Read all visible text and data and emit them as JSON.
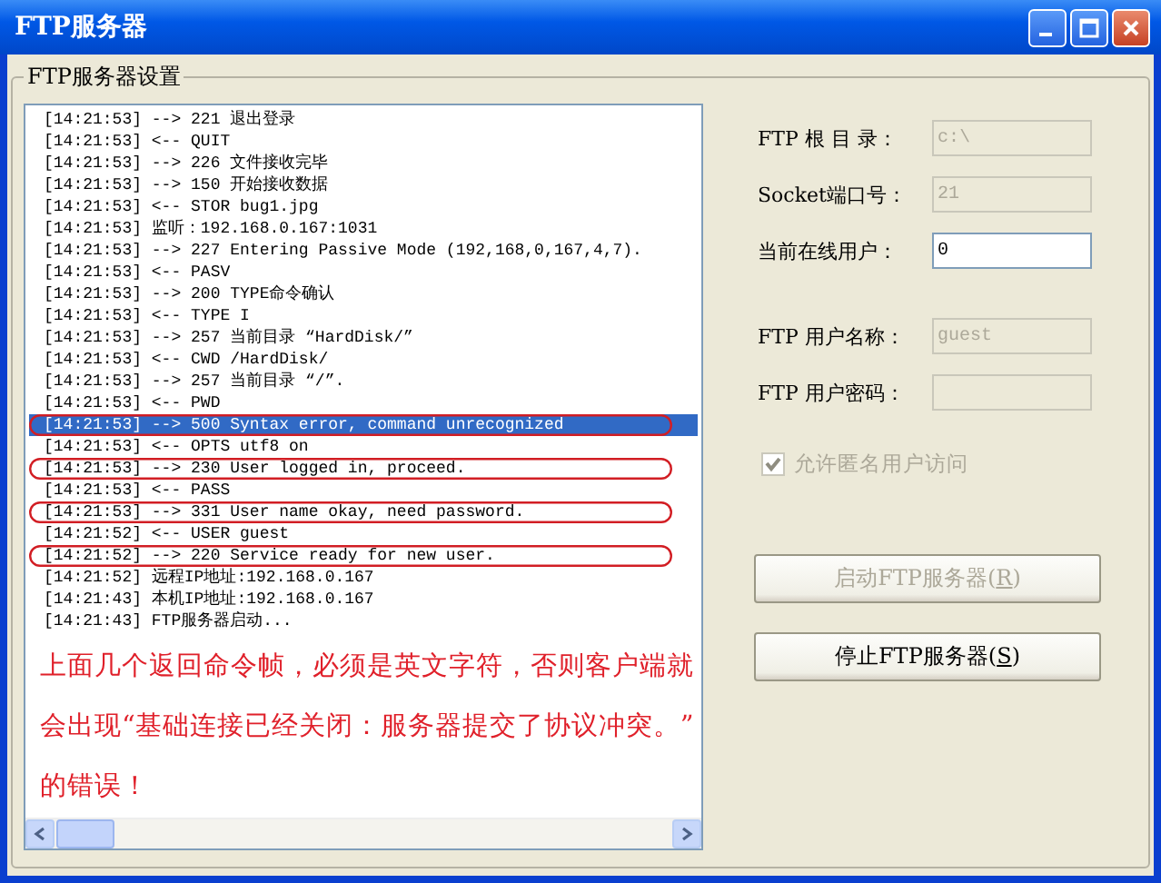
{
  "window": {
    "title": "FTP服务器"
  },
  "group": {
    "title": "FTP服务器设置"
  },
  "log": {
    "lines": [
      {
        "text": "[14:21:53] --> 221 退出登录",
        "selected": false,
        "circled": false
      },
      {
        "text": "[14:21:53] <-- QUIT",
        "selected": false,
        "circled": false
      },
      {
        "text": "[14:21:53] --> 226 文件接收完毕",
        "selected": false,
        "circled": false
      },
      {
        "text": "[14:21:53] --> 150 开始接收数据",
        "selected": false,
        "circled": false
      },
      {
        "text": "[14:21:53] <-- STOR bug1.jpg",
        "selected": false,
        "circled": false
      },
      {
        "text": "[14:21:53] 监听：192.168.0.167:1031",
        "selected": false,
        "circled": false
      },
      {
        "text": "[14:21:53] --> 227 Entering Passive Mode (192,168,0,167,4,7).",
        "selected": false,
        "circled": false
      },
      {
        "text": "[14:21:53] <-- PASV",
        "selected": false,
        "circled": false
      },
      {
        "text": "[14:21:53] --> 200 TYPE命令确认",
        "selected": false,
        "circled": false
      },
      {
        "text": "[14:21:53] <-- TYPE I",
        "selected": false,
        "circled": false
      },
      {
        "text": "[14:21:53] --> 257 当前目录 “HardDisk/”",
        "selected": false,
        "circled": false
      },
      {
        "text": "[14:21:53] <-- CWD /HardDisk/",
        "selected": false,
        "circled": false
      },
      {
        "text": "[14:21:53] --> 257 当前目录 “/”.",
        "selected": false,
        "circled": false
      },
      {
        "text": "[14:21:53] <-- PWD",
        "selected": false,
        "circled": false
      },
      {
        "text": "[14:21:53] --> 500 Syntax error, command unrecognized",
        "selected": true,
        "circled": true
      },
      {
        "text": "[14:21:53] <-- OPTS utf8 on",
        "selected": false,
        "circled": false
      },
      {
        "text": "[14:21:53] --> 230 User logged in, proceed.",
        "selected": false,
        "circled": true
      },
      {
        "text": "[14:21:53] <-- PASS",
        "selected": false,
        "circled": false
      },
      {
        "text": "[14:21:53] --> 331 User name okay, need password.",
        "selected": false,
        "circled": true
      },
      {
        "text": "[14:21:52] <-- USER guest",
        "selected": false,
        "circled": false
      },
      {
        "text": "[14:21:52] --> 220 Service ready for new user.",
        "selected": false,
        "circled": true
      },
      {
        "text": "[14:21:52] 远程IP地址:192.168.0.167",
        "selected": false,
        "circled": false
      },
      {
        "text": "[14:21:43] 本机IP地址:192.168.0.167",
        "selected": false,
        "circled": false
      },
      {
        "text": "[14:21:43] FTP服务器启动...",
        "selected": false,
        "circled": false
      }
    ],
    "note_lines": [
      "上面几个返回命令帧，必须是英文字符，否则客户端就",
      "会出现“基础连接已经关闭：服务器提交了协议冲突。”",
      "的错误！"
    ]
  },
  "settings": {
    "fields": [
      {
        "label": "FTP 根 目 录：",
        "value": "c:\\",
        "disabled": true
      },
      {
        "label": "Socket端口号：",
        "value": "21",
        "disabled": true
      },
      {
        "label": "当前在线用户：",
        "value": "0",
        "disabled": false
      },
      {
        "label": "FTP 用户名称：",
        "value": "guest",
        "disabled": true
      },
      {
        "label": "FTP 用户密码：",
        "disabled": true
      }
    ],
    "anonymous": {
      "label": "允许匿名用户访问",
      "checked": true,
      "disabled": true
    },
    "buttons": [
      {
        "text_before": "启动FTP服务器(",
        "accesskey": "R",
        "text_after": ")",
        "disabled": true
      },
      {
        "text_before": "停止FTP服务器(",
        "accesskey": "S",
        "text_after": ")",
        "disabled": false
      }
    ]
  }
}
